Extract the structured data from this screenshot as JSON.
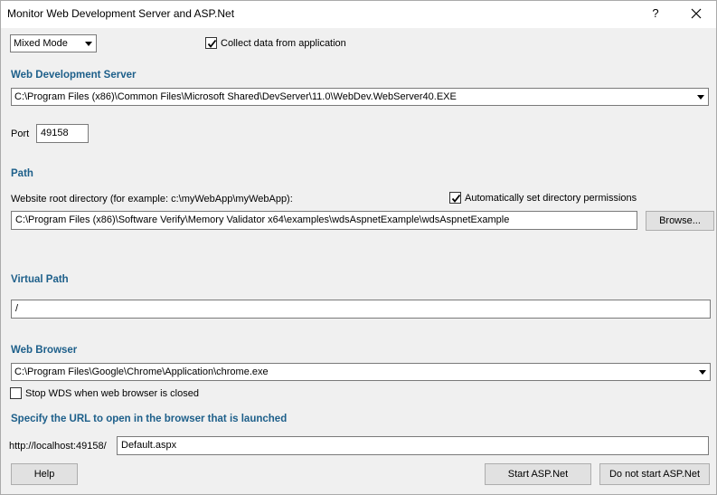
{
  "window": {
    "title": "Monitor Web Development Server and ASP.Net",
    "help_glyph": "?"
  },
  "mode": {
    "selected": "Mixed Mode",
    "collect_label": "Collect data from application",
    "collect_checked": true
  },
  "wds": {
    "heading": "Web Development Server",
    "server_path": "C:\\Program Files (x86)\\Common Files\\Microsoft Shared\\DevServer\\11.0\\WebDev.WebServer40.EXE",
    "port_label": "Port",
    "port_value": "49158"
  },
  "path": {
    "heading": "Path",
    "root_label": "Website root directory (for example: c:\\myWebApp\\myWebApp):",
    "auto_perm_label": "Automatically set directory permissions",
    "auto_perm_checked": true,
    "root_value": "C:\\Program Files (x86)\\Software Verify\\Memory Validator x64\\examples\\wdsAspnetExample\\wdsAspnetExample",
    "browse_label": "Browse..."
  },
  "virtual": {
    "heading": "Virtual Path",
    "value": "/"
  },
  "browser": {
    "heading": "Web Browser",
    "path": "C:\\Program Files\\Google\\Chrome\\Application\\chrome.exe",
    "stop_label": "Stop WDS when web browser is closed",
    "stop_checked": false
  },
  "url": {
    "heading": "Specify the URL to open in the browser that is launched",
    "prefix": "http://localhost:49158/",
    "page": "Default.aspx"
  },
  "buttons": {
    "help": "Help",
    "start": "Start ASP.Net",
    "no_start": "Do not start ASP.Net"
  },
  "colors": {
    "heading": "#1d5f8a",
    "background": "#f0f0f0"
  }
}
